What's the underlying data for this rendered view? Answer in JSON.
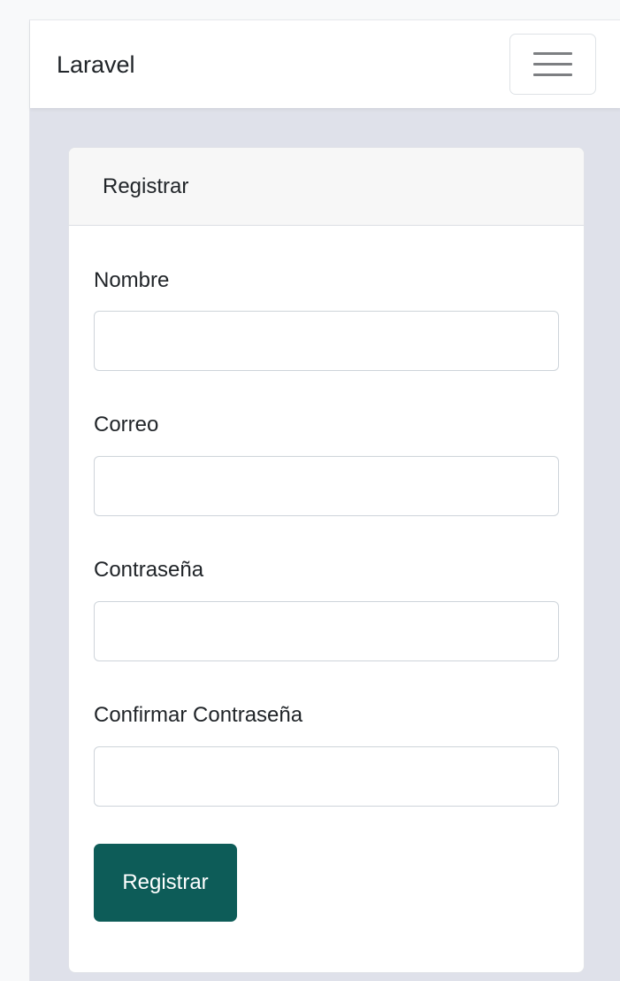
{
  "navbar": {
    "brand": "Laravel",
    "toggler_icon": "hamburger-menu-icon"
  },
  "card": {
    "header": "Registrar",
    "fields": [
      {
        "label": "Nombre",
        "value": "",
        "placeholder": ""
      },
      {
        "label": "Correo",
        "value": "",
        "placeholder": ""
      },
      {
        "label": "Contraseña",
        "value": "",
        "placeholder": ""
      },
      {
        "label": "Confirmar Contraseña",
        "value": "",
        "placeholder": ""
      }
    ],
    "submit_label": "Registrar"
  },
  "colors": {
    "primary_button": "#0d5c58",
    "page_background": "#dfe1ea",
    "navbar_background": "#ffffff"
  }
}
